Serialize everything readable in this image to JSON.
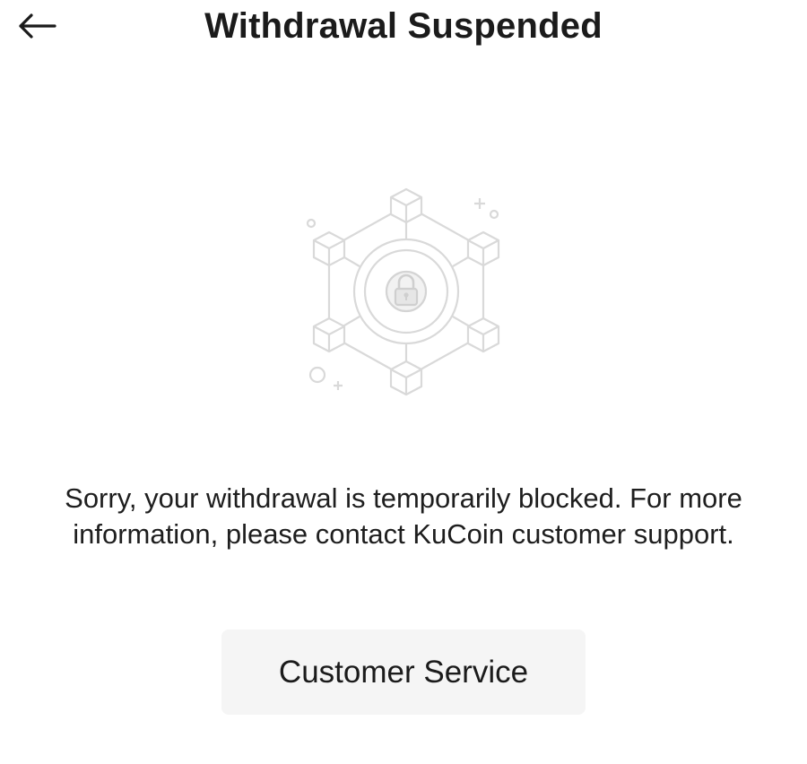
{
  "header": {
    "title": "Withdrawal Suspended",
    "back_icon": "arrow-left-icon"
  },
  "illustration": {
    "icon": "lock-network-icon",
    "color": "#d9d9d9"
  },
  "message": "Sorry, your withdrawal is temporarily blocked. For more information, please contact KuCoin customer support.",
  "actions": {
    "customer_service_label": "Customer Service"
  }
}
